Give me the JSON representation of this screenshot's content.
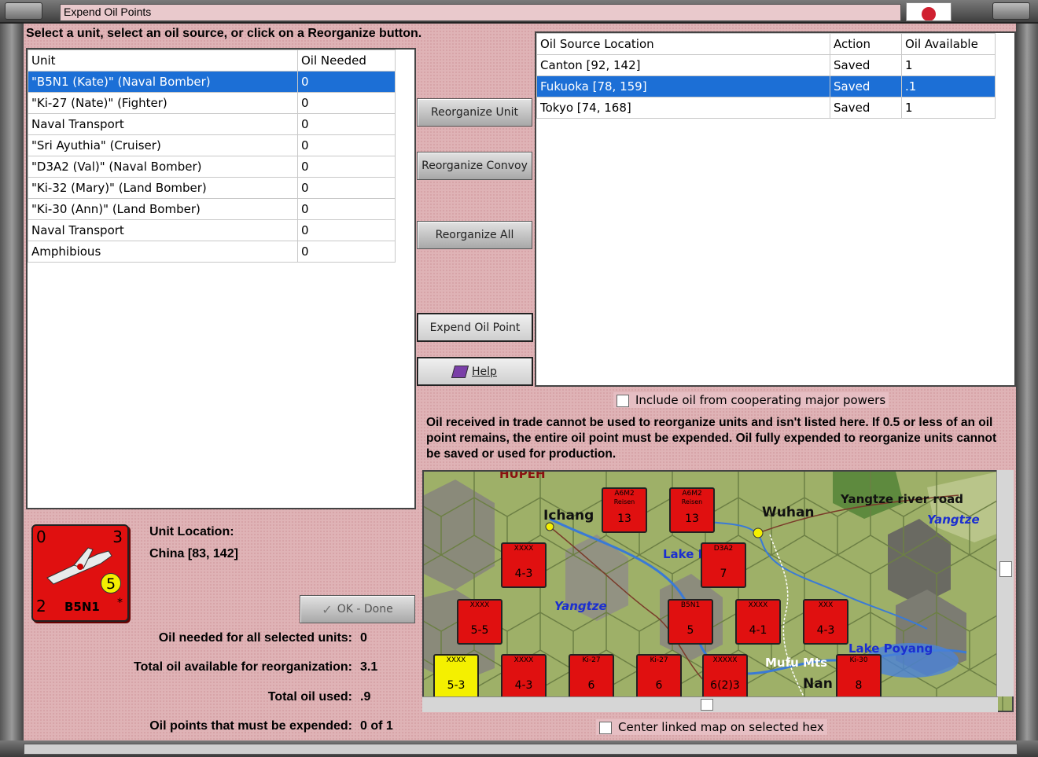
{
  "window": {
    "title": "Expend Oil Points"
  },
  "instruction": "Select a unit, select an oil source, or click on a Reorganize button.",
  "units_table": {
    "headers": [
      "Unit",
      "Oil Needed"
    ],
    "rows": [
      {
        "unit": "\"B5N1 (Kate)\" (Naval Bomber)",
        "oil": "0"
      },
      {
        "unit": "\"Ki-27 (Nate)\" (Fighter)",
        "oil": "0"
      },
      {
        "unit": "Naval Transport",
        "oil": "0"
      },
      {
        "unit": "\"Sri Ayuthia\" (Cruiser)",
        "oil": "0"
      },
      {
        "unit": "\"D3A2 (Val)\" (Naval Bomber)",
        "oil": "0"
      },
      {
        "unit": "\"Ki-32 (Mary)\" (Land Bomber)",
        "oil": "0"
      },
      {
        "unit": "\"Ki-30 (Ann)\" (Land Bomber)",
        "oil": "0"
      },
      {
        "unit": "Naval Transport",
        "oil": "0"
      },
      {
        "unit": "Amphibious",
        "oil": "0"
      }
    ],
    "selected_index": 0
  },
  "oil_table": {
    "headers": [
      "Oil Source Location",
      "Action",
      "Oil Available"
    ],
    "rows": [
      {
        "location": "Canton [92, 142]",
        "action": "Saved",
        "available": "1"
      },
      {
        "location": "Fukuoka [78, 159]",
        "action": "Saved",
        "available": ".1"
      },
      {
        "location": "Tokyo [74, 168]",
        "action": "Saved",
        "available": "1"
      }
    ],
    "selected_index": 1
  },
  "buttons": {
    "reorganize_unit": "Reorganize Unit",
    "reorganize_convoy": "Reorganize Convoy",
    "reorganize_all": "Reorganize All",
    "expend_oil_point": "Expend Oil Point",
    "help": "Help",
    "ok_done": "OK - Done"
  },
  "include_oil_label": "Include oil from cooperating major powers",
  "note": "Oil received in trade cannot be used to reorganize units and isn't listed here.  If 0.5 or less of an oil point remains, the entire oil point must be expended.   Oil fully expended to reorganize units cannot be saved or used for production.",
  "unit_counter": {
    "top_left": "0",
    "top_right": "3",
    "bottom_left": "2",
    "name": "B5N1",
    "factor": "5",
    "star": "*"
  },
  "unit_location": {
    "label": "Unit Location:",
    "value": "China [83, 142]"
  },
  "summary": {
    "oil_needed_label": "Oil needed for all selected units:",
    "oil_needed_value": "0",
    "oil_available_label": "Total oil available for reorganization:",
    "oil_available_value": "3.1",
    "oil_used_label": "Total oil used:",
    "oil_used_value": ".9",
    "must_expend_label": "Oil points that must be expended:",
    "must_expend_value": "0 of 1"
  },
  "map": {
    "labels": [
      "HUPEH",
      "Ichang",
      "Wuhan",
      "Yangtze river road",
      "Yangtze",
      "Lake I",
      "Yangtze",
      "Lake Poyang",
      "Mufu Mts",
      "Nan"
    ],
    "counters": [
      {
        "name": "A6M2",
        "sub": "Reisen",
        "value": "13"
      },
      {
        "name": "A6M2",
        "sub": "Reisen",
        "value": "13"
      },
      {
        "name": "XXXX",
        "sub": "",
        "value": "4-3"
      },
      {
        "name": "D3A2",
        "sub": "",
        "value": "7"
      },
      {
        "name": "XXXX",
        "sub": "",
        "value": "5-5"
      },
      {
        "name": "B5N1",
        "sub": "",
        "value": "5"
      },
      {
        "name": "XXXX",
        "sub": "",
        "value": "4-1"
      },
      {
        "name": "XXX",
        "sub": "",
        "value": "4-3"
      },
      {
        "name": "XXXX",
        "sub": "",
        "value": "5-3"
      },
      {
        "name": "XXXX",
        "sub": "",
        "value": "4-3"
      },
      {
        "name": "Ki-27",
        "sub": "",
        "value": "6"
      },
      {
        "name": "Ki-27",
        "sub": "",
        "value": "6"
      },
      {
        "name": "XXXXX",
        "sub": "",
        "value": "6(2)3"
      },
      {
        "name": "Ki-30",
        "sub": "",
        "value": "8"
      }
    ]
  },
  "center_map_label": "Center linked map on selected hex",
  "colors": {
    "panel_pink": "#dfb3b6",
    "selection_blue": "#1c6fd6",
    "counter_red": "#e01010",
    "counter_yellow": "#f4f000"
  }
}
